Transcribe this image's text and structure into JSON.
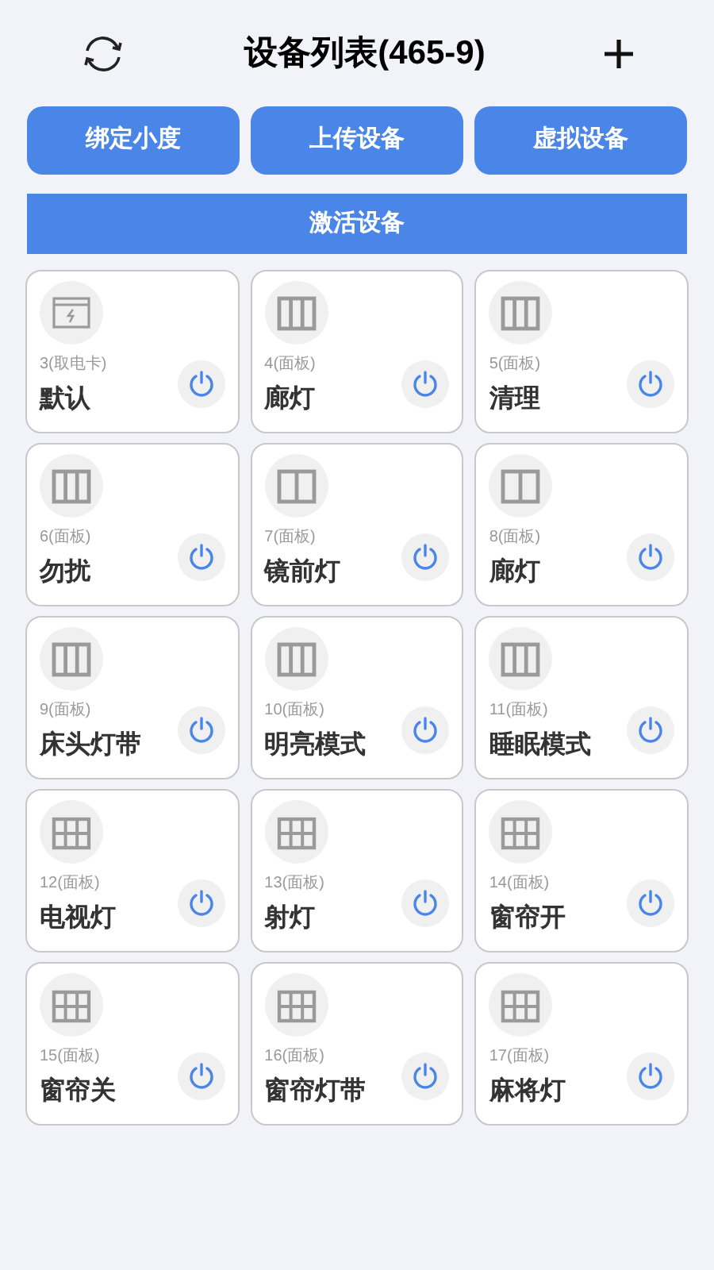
{
  "header": {
    "title": "设备列表(465-9)"
  },
  "actions": [
    "绑定小度",
    "上传设备",
    "虚拟设备"
  ],
  "activate_button": "激活设备",
  "devices": [
    {
      "kind": "card",
      "subtitle": "3(取电卡)",
      "name": "默认"
    },
    {
      "kind": "panel3",
      "subtitle": "4(面板)",
      "name": "廊灯"
    },
    {
      "kind": "panel3",
      "subtitle": "5(面板)",
      "name": "清理"
    },
    {
      "kind": "panel3",
      "subtitle": "6(面板)",
      "name": "勿扰"
    },
    {
      "kind": "panel2",
      "subtitle": "7(面板)",
      "name": "镜前灯"
    },
    {
      "kind": "panel2",
      "subtitle": "8(面板)",
      "name": "廊灯"
    },
    {
      "kind": "panel3",
      "subtitle": "9(面板)",
      "name": "床头灯带"
    },
    {
      "kind": "panel3",
      "subtitle": "10(面板)",
      "name": "明亮模式"
    },
    {
      "kind": "panel3",
      "subtitle": "11(面板)",
      "name": "睡眠模式"
    },
    {
      "kind": "grid6",
      "subtitle": "12(面板)",
      "name": "电视灯"
    },
    {
      "kind": "grid6",
      "subtitle": "13(面板)",
      "name": "射灯"
    },
    {
      "kind": "grid6",
      "subtitle": "14(面板)",
      "name": "窗帘开"
    },
    {
      "kind": "grid6",
      "subtitle": "15(面板)",
      "name": "窗帘关"
    },
    {
      "kind": "grid6",
      "subtitle": "16(面板)",
      "name": "窗帘灯带"
    },
    {
      "kind": "grid6",
      "subtitle": "17(面板)",
      "name": "麻将灯"
    }
  ]
}
